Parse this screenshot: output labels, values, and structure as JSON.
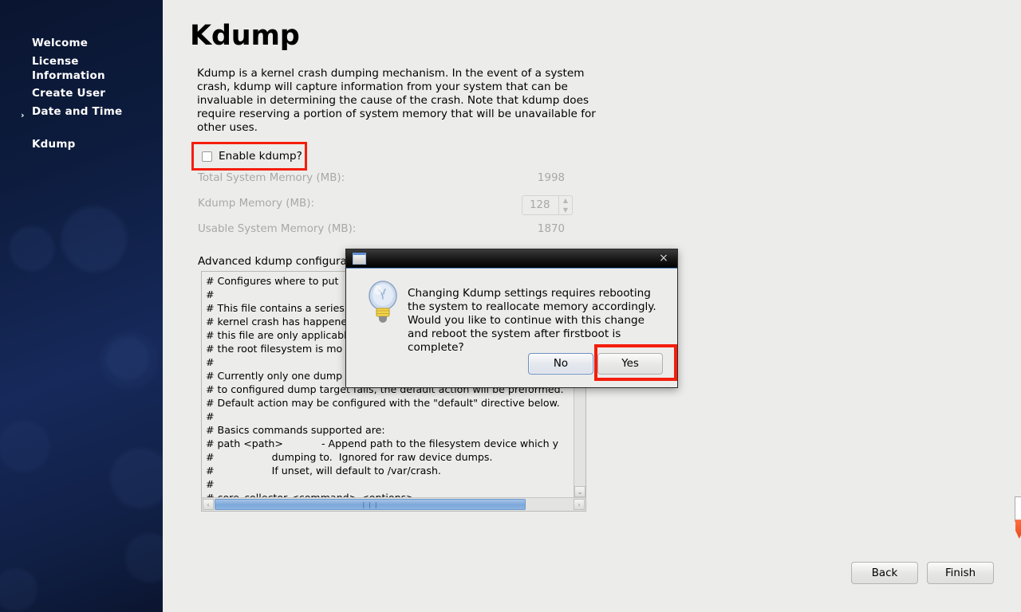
{
  "sidebar": {
    "items": [
      {
        "label": "Welcome",
        "selected": false
      },
      {
        "label": "License\nInformation",
        "selected": false
      },
      {
        "label": "Create User",
        "selected": false
      },
      {
        "label": "Date and Time",
        "selected": false
      },
      {
        "label": "Kdump",
        "selected": true
      }
    ],
    "selected_marker": "›"
  },
  "main": {
    "title": "Kdump",
    "intro": "Kdump is a kernel crash dumping mechanism. In the event of a system crash, kdump will capture information from your system that can be invaluable in determining the cause of the crash. Note that kdump does require reserving a portion of system memory that will be unavailable for other uses.",
    "enable_checkbox": {
      "label": "Enable kdump?",
      "checked": false
    },
    "memory": {
      "total_label": "Total System Memory (MB):",
      "total_value": "1998",
      "kdump_label": "Kdump Memory (MB):",
      "kdump_value": "128",
      "usable_label": "Usable System Memory (MB):",
      "usable_value": "1870"
    },
    "advanced_label": "Advanced kdump configurat",
    "config_text": "# Configures where to put\n#\n# This file contains a series\n# kernel crash has happene\n# this file are only applicabl\n# the root filesystem is mo\n#\n# Currently only one dump\n# to configured dump target fails, the default action will be preformed.\n# Default action may be configured with the \"default\" directive below.\n#\n# Basics commands supported are:\n# path <path>            - Append path to the filesystem device which y\n#                  dumping to.  Ignored for raw device dumps.\n#                  If unset, will default to /var/crash.\n#\n# core_collector <command> <options>",
    "scrollbar": {
      "h_left_arrow": "‹",
      "h_right_arrow": "›",
      "h_grip": "❘❘❘",
      "v_down_arrow": "⌄"
    },
    "buttons": {
      "back": "Back",
      "finish": "Finish"
    }
  },
  "dialog": {
    "title": "",
    "close_label": "×",
    "message": "Changing Kdump settings requires rebooting the system to reallocate memory accordingly. Would you like to continue with this change and reboot the system after firstboot is complete?",
    "no_label": "No",
    "yes_label": "Yes"
  },
  "annotations": {
    "highlight_color": "#f41e0c"
  }
}
